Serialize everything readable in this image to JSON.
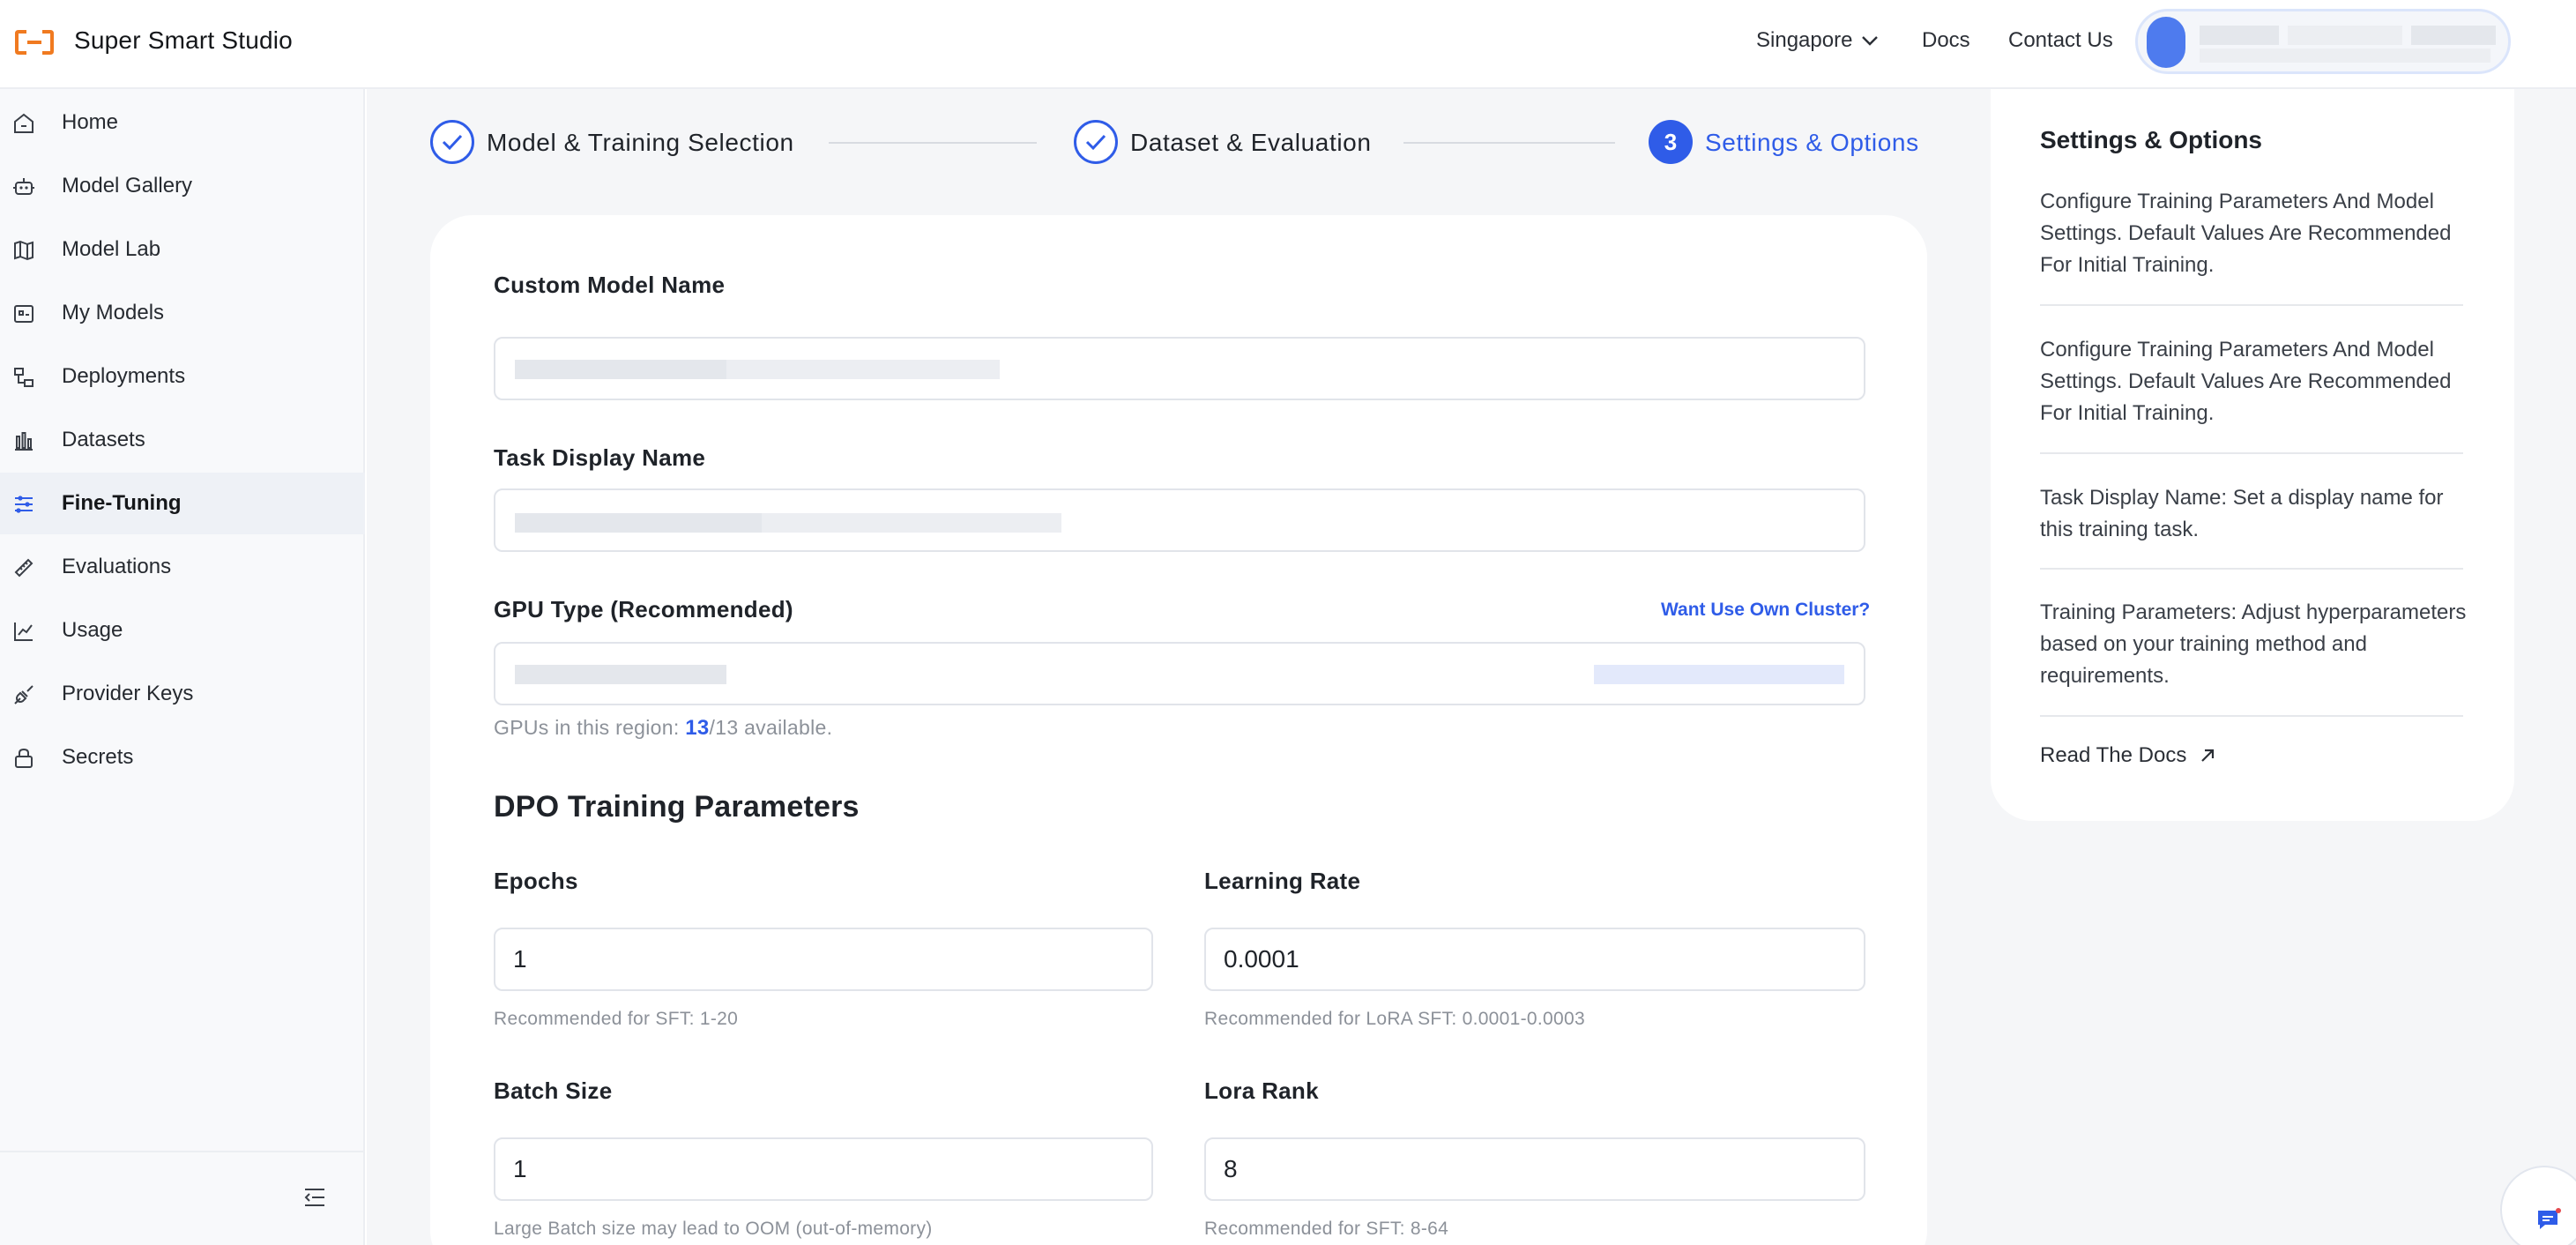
{
  "app": {
    "brand": "Super Smart Studio"
  },
  "header": {
    "region": "Singapore",
    "docs": "Docs",
    "contact": "Contact Us",
    "icons": {
      "logo": "bracket-logo-icon",
      "region_caret": "chevron-down-icon",
      "user": "avatar"
    }
  },
  "sidebar": {
    "items": [
      {
        "label": "Home",
        "icon": "home-icon"
      },
      {
        "label": "Model Gallery",
        "icon": "robot-icon"
      },
      {
        "label": "Model Lab",
        "icon": "map-icon"
      },
      {
        "label": "My Models",
        "icon": "model-folder-icon"
      },
      {
        "label": "Deployments",
        "icon": "deploy-icon"
      },
      {
        "label": "Datasets",
        "icon": "bar-chart-icon"
      },
      {
        "label": "Fine-Tuning",
        "icon": "sliders-icon",
        "active": true
      },
      {
        "label": "Evaluations",
        "icon": "ruler-icon"
      },
      {
        "label": "Usage",
        "icon": "usage-chart-icon"
      },
      {
        "label": "Provider Keys",
        "icon": "plug-icon"
      },
      {
        "label": "Secrets",
        "icon": "lock-icon"
      }
    ],
    "collapse_icon": "collapse-menu-icon"
  },
  "stepper": {
    "steps": [
      {
        "label": "Model & Training Selection",
        "state": "done"
      },
      {
        "label": "Dataset & Evaluation",
        "state": "done"
      },
      {
        "label": "Settings & Options",
        "state": "current",
        "number": "3"
      }
    ]
  },
  "form": {
    "custom_model_name": {
      "label": "Custom Model Name",
      "value": ""
    },
    "task_display_name": {
      "label": "Task Display Name",
      "value": ""
    },
    "gpu_type": {
      "label": "GPU Type (Recommended)",
      "link": "Want Use Own Cluster?",
      "hint_prefix": "GPUs in this region: ",
      "available": "13",
      "hint_suffix": "/13 available."
    },
    "section_title": "DPO Training Parameters",
    "epochs": {
      "label": "Epochs",
      "value": "1",
      "hint": "Recommended for SFT: 1-20"
    },
    "learning_rate": {
      "label": "Learning Rate",
      "value": "0.0001",
      "hint": "Recommended for LoRA SFT: 0.0001-0.0003"
    },
    "batch_size": {
      "label": "Batch Size",
      "value": "1",
      "hint": "Large Batch size may lead to OOM (out-of-memory)"
    },
    "lora_rank": {
      "label": "Lora Rank",
      "value": "8",
      "hint": "Recommended for SFT: 8-64"
    }
  },
  "help_panel": {
    "title": "Settings & Options",
    "paragraphs": [
      "Configure Training Parameters And Model Settings. Default Values Are Recommended For Initial Training.",
      "Configure Training Parameters And Model Settings. Default Values Are Recommended For Initial Training.",
      "Task Display Name: Set a display name for this training task.",
      "Training Parameters: Adjust hyperparameters based on your training method and requirements."
    ],
    "link": "Read The Docs",
    "link_icon": "arrow-up-right-icon"
  },
  "colors": {
    "accent": "#2f5ce8",
    "brand_orange": "#f07a20",
    "sidebar_bg": "#f8f9fb",
    "main_bg": "#f5f6f8"
  }
}
